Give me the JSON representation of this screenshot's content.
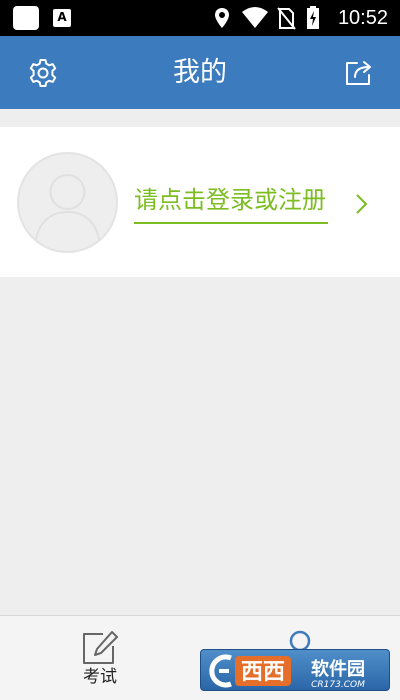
{
  "status_bar": {
    "time": "10:52",
    "icons": [
      "app-square-icon",
      "app-a-icon",
      "location-icon",
      "wifi-icon",
      "no-sim-icon",
      "battery-charging-icon"
    ],
    "app_a_letter": "A"
  },
  "header": {
    "title": "我的",
    "left_icon": "gear-icon",
    "right_icon": "share-icon",
    "background": "#3d7bbf"
  },
  "profile": {
    "login_text": "请点击登录或注册",
    "link_color": "#7cbd22",
    "avatar_icon": "default-avatar-icon",
    "chevron_icon": "chevron-right-icon"
  },
  "bottom_nav": {
    "items": [
      {
        "label": "考试",
        "icon": "pencil-edit-icon",
        "selected": false
      },
      {
        "label": "",
        "icon": "person-icon",
        "selected": true
      }
    ]
  },
  "watermark": {
    "brand": "西西软件园",
    "url": "CR173.COM"
  }
}
